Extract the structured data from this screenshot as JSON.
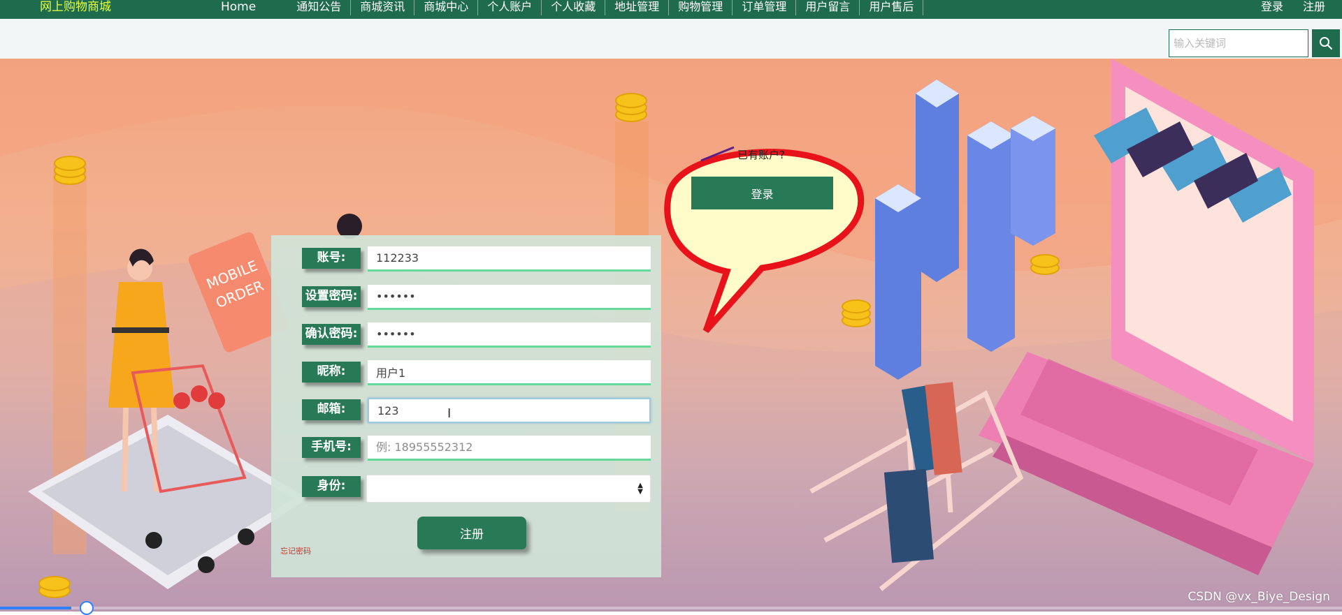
{
  "header": {
    "brand": "网上购物商城",
    "nav": [
      "Home",
      "通知公告",
      "商城资讯",
      "商城中心",
      "个人账户",
      "个人收藏",
      "地址管理",
      "购物管理",
      "订单管理",
      "用户留言",
      "用户售后"
    ],
    "login": "登录",
    "register": "注册"
  },
  "search": {
    "placeholder": "输入关键词",
    "icon": "search-icon"
  },
  "bubble": {
    "question": "已有账户?",
    "login_button": "登录"
  },
  "form": {
    "account": {
      "label": "账号:",
      "value": "112233"
    },
    "password": {
      "label": "设置密码:",
      "value": "aaaaaa"
    },
    "confirm": {
      "label": "确认密码:",
      "value": "aaaaaa"
    },
    "nickname": {
      "label": "昵称:",
      "value": "用户1"
    },
    "email": {
      "label": "邮箱:",
      "value": "123"
    },
    "phone": {
      "label": "手机号:",
      "placeholder": "例: 18955552312",
      "value": ""
    },
    "identity": {
      "label": "身份:",
      "value": ""
    },
    "submit": "注册",
    "forgot": "忘记密码"
  },
  "hero_art": {
    "sign_text": "MOBILE ORDER"
  },
  "media": {
    "progress": 0.053
  },
  "watermark": "CSDN @vx_Biye_Design",
  "colors": {
    "primary": "#1e6b4e",
    "button": "#277a55",
    "brand_text": "#e8ff3c",
    "field_accent": "#63d99a"
  }
}
